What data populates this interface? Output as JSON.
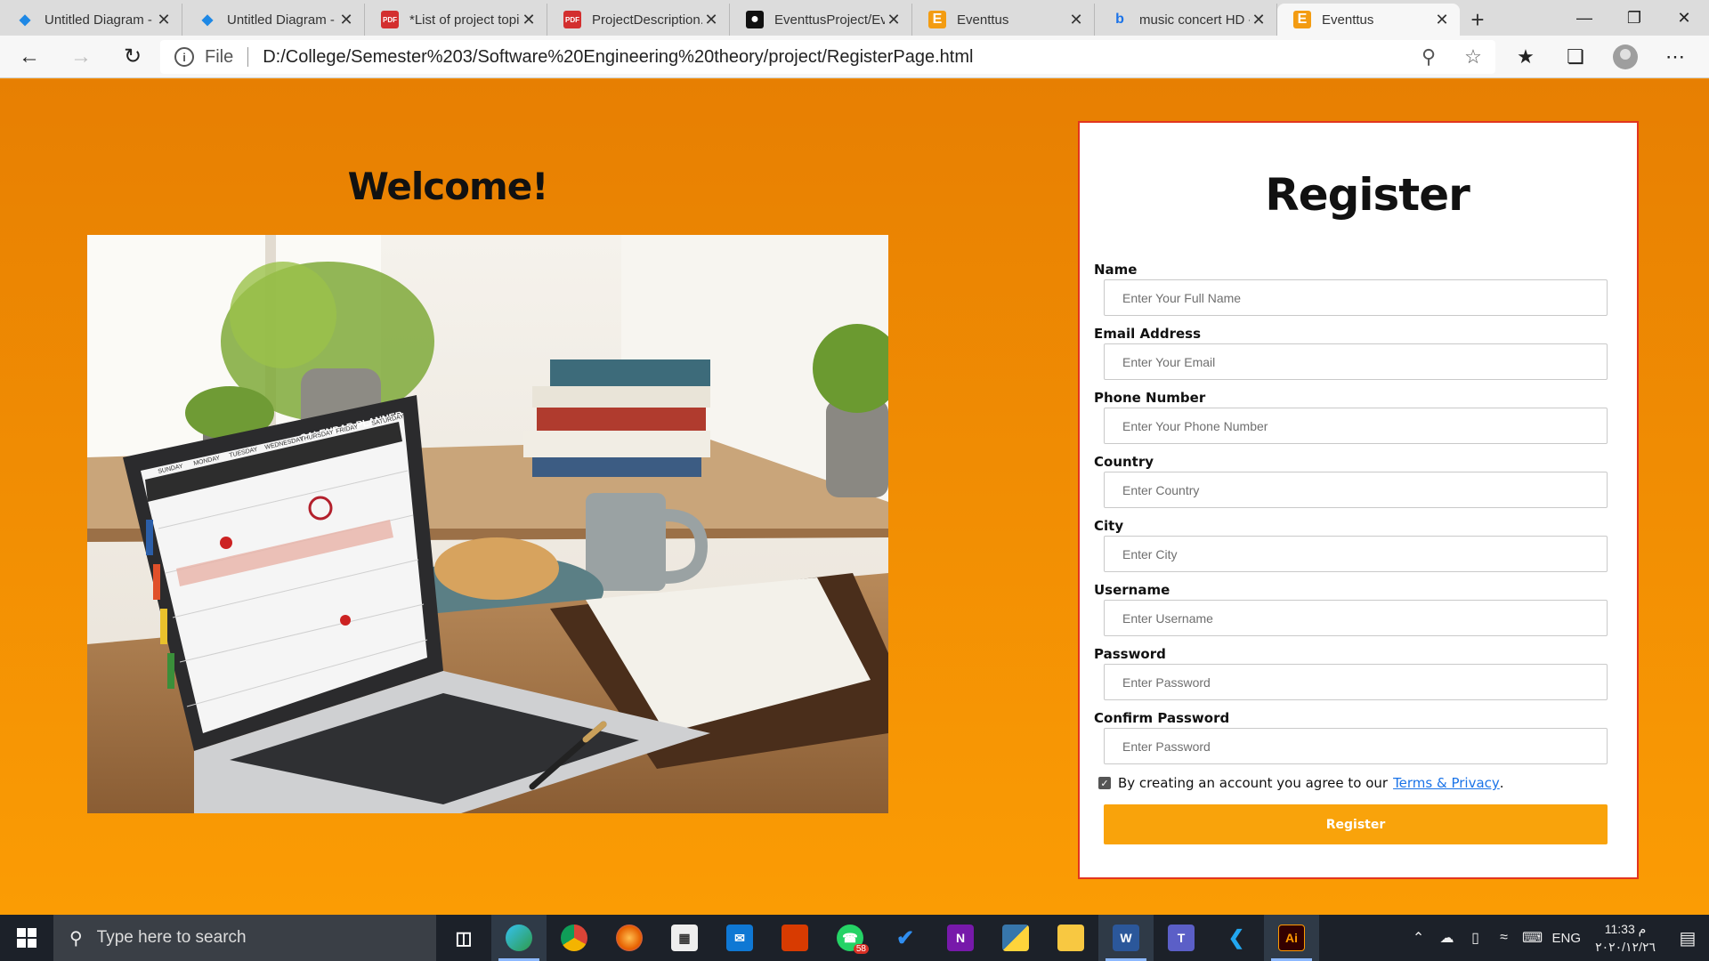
{
  "browser": {
    "tabs": [
      {
        "title": "Untitled Diagram - d",
        "icon": "drawio-icon",
        "active": false
      },
      {
        "title": "Untitled Diagram - d",
        "icon": "drawio-icon",
        "active": false
      },
      {
        "title": "*List of project topi",
        "icon": "pdf-icon",
        "active": false
      },
      {
        "title": "ProjectDescription.p",
        "icon": "pdf-icon",
        "active": false
      },
      {
        "title": "EventtusProject/Eve",
        "icon": "github-icon",
        "active": false
      },
      {
        "title": "Eventtus",
        "icon": "eventtus-icon",
        "active": false
      },
      {
        "title": "music concert HD - B",
        "icon": "bing-icon",
        "active": false
      },
      {
        "title": "Eventtus",
        "icon": "eventtus-icon",
        "active": true
      }
    ],
    "address": {
      "scheme_label": "File",
      "url": "D:/College/Semester%203/Software%20Engineering%20theory/project/RegisterPage.html"
    }
  },
  "page": {
    "welcome": "Welcome!",
    "register": {
      "title": "Register",
      "fields": [
        {
          "label": "Name",
          "placeholder": "Enter Your Full Name"
        },
        {
          "label": "Email Address",
          "placeholder": "Enter Your Email"
        },
        {
          "label": "Phone Number",
          "placeholder": "Enter Your Phone Number"
        },
        {
          "label": "Country",
          "placeholder": "Enter Country"
        },
        {
          "label": "City",
          "placeholder": "Enter City"
        },
        {
          "label": "Username",
          "placeholder": "Enter Username"
        },
        {
          "label": "Password",
          "placeholder": "Enter Password"
        },
        {
          "label": "Confirm Password",
          "placeholder": "Enter Password"
        }
      ],
      "agree_text": "By creating an account you agree to our",
      "agree_link": "Terms & Privacy",
      "agree_after": ".",
      "agree_checked": true,
      "button": "Register"
    },
    "hero_image": {
      "calendar_title": "CALENDAR PLANNER",
      "days": [
        "SUNDAY",
        "MONDAY",
        "TUESDAY",
        "WEDNESDAY",
        "THURSDAY",
        "FRIDAY",
        "SATURDAY"
      ]
    }
  },
  "taskbar": {
    "search_placeholder": "Type here to search",
    "whatsapp_badge": "58",
    "language": "ENG",
    "time": "11:33 م",
    "date": "٢٠٢٠/١٢/٢٦"
  },
  "colors": {
    "page_top": "#e77f02",
    "page_bottom": "#fb9c04",
    "card_border": "#e2351e",
    "button": "#f9a30b",
    "link": "#1a73e8"
  }
}
